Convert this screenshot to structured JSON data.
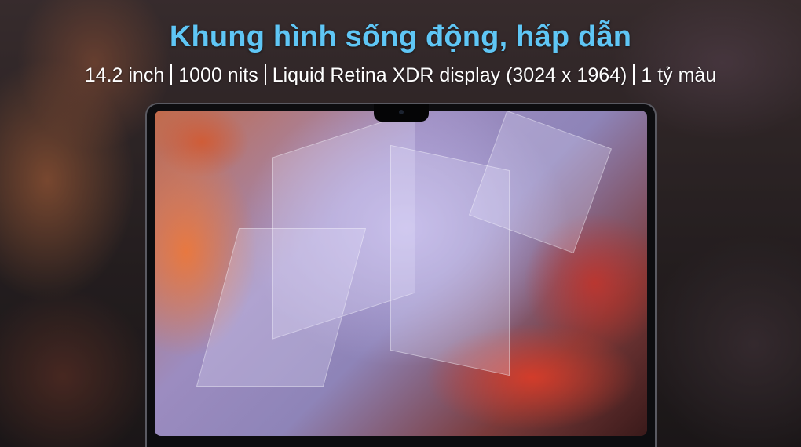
{
  "banner": {
    "title": "Khung hình sống động, hấp dẫn",
    "specs": [
      "14.2 inch",
      "1000 nits",
      "Liquid Retina XDR display (3024 x 1964)",
      "1 tỷ màu"
    ]
  },
  "colors": {
    "title": "#5fc6f5",
    "specs_text": "#ffffff"
  }
}
